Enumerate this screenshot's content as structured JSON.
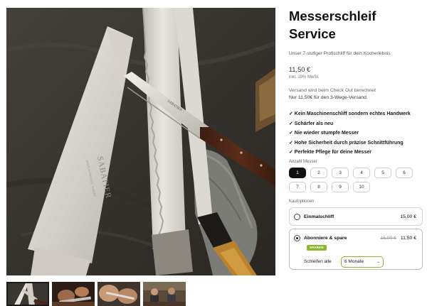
{
  "product": {
    "title_line1": "Messerschleif",
    "title_line2": "Service",
    "subtitle": "Unser 7-stufiger Profischliff für dein Kocherlebnis",
    "price": "11,50 €",
    "tax_note": "inkl. 19% MwSt.",
    "shipping_note": "Versand wird beim Check Out berechnet",
    "shipping_offer": "Nur 11,50€ für den 3-Wege-Versand."
  },
  "features": [
    "✓ Kein Maschinenschliff sondern echtes Handwerk",
    "✓ Schärfer als neu",
    "✓ Nie wieder stumpfe Messer",
    "✓ Hohe Sicherheit durch präzise Schnittführung",
    "✓ Perfekte Pflege für deine Messer"
  ],
  "quantity": {
    "label": "Anzahl Messer",
    "options": [
      "1",
      "2",
      "3",
      "4",
      "5",
      "6",
      "7",
      "8",
      "9",
      "10"
    ],
    "selected": "1"
  },
  "purchase": {
    "label": "Kaufoptionen",
    "one_time": {
      "name": "Einmalschliff",
      "price": "15,00 €"
    },
    "subscription": {
      "name": "Abonniere & spare",
      "badge": "SPAREN",
      "old_price": "15,00 €",
      "price": "11,50 €",
      "interval_label": "Schleifen alle",
      "interval_value": "6 Monate"
    }
  },
  "gallery": {
    "main_image": "knives-on-slate",
    "thumbnails": [
      "knives-on-slate",
      "sharpening-hands",
      "knife-closeup",
      "workshop-people"
    ],
    "blade_engraving": "SABATIER"
  },
  "colors": {
    "accent_green": "#8bb82a",
    "selected_black": "#111111",
    "border_gray": "#d4d4d4"
  }
}
